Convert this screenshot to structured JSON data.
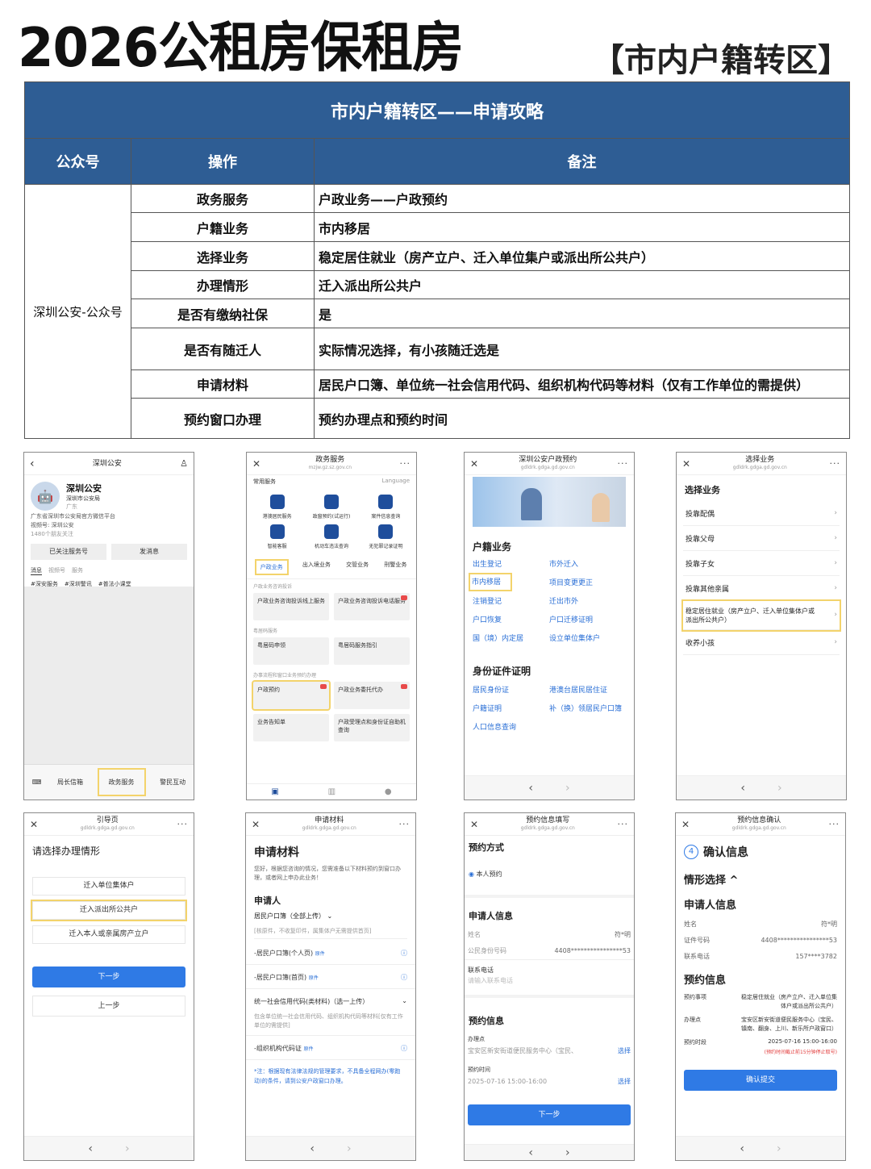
{
  "header": {
    "title": "2026公租房保租房",
    "tag": "【市内户籍转区】"
  },
  "guide": {
    "title": "市内户籍转区——申请攻略",
    "columns": [
      "公众号",
      "操作",
      "备注"
    ],
    "account": "深圳公安-公众号",
    "rows": [
      {
        "op": "政务服务",
        "note": "户政业务——户政预约"
      },
      {
        "op": "户籍业务",
        "note": "市内移居"
      },
      {
        "op": "选择业务",
        "note": "稳定居住就业（房产立户、迁入单位集户或派出所公共户）"
      },
      {
        "op": "办理情形",
        "note": "迁入派出所公共户"
      },
      {
        "op": "是否有缴纳社保",
        "note": "是"
      },
      {
        "op": "是否有随迁人",
        "note": "实际情况选择，有小孩随迁选是"
      },
      {
        "op": "申请材料",
        "note": "居民户口簿、单位统一社会信用代码、组织机构代码等材料（仅有工作单位的需提供）"
      },
      {
        "op": "预约窗口办理",
        "note": "预约办理点和预约时间"
      }
    ]
  },
  "p1": {
    "top_title": "深圳公安",
    "name": "深圳公安",
    "org": "深圳市公安局",
    "region": "广东",
    "desc": "广东省深圳市公安局官方微信平台",
    "video": "视频号: 深圳公安",
    "friends": "1480个朋友关注",
    "btn_follow": "已关注服务号",
    "btn_msg": "发消息",
    "tabs": [
      "消息",
      "视频号",
      "服务"
    ],
    "tags": [
      "#深安服务",
      "#深圳警讯",
      "#普法小课堂"
    ],
    "menu": [
      "局长信箱",
      "政务服务",
      "警民互动"
    ]
  },
  "p2": {
    "top_title": "政务服务",
    "top_sub": "mzjw.gz.sz.gov.cn",
    "section": "常用服务",
    "lang": "Language",
    "icons": [
      "港澳居民服务",
      "政窗预约(试运行)",
      "案件信息查询",
      "智能客服",
      "机动车违法查询",
      "无犯罪记录证明"
    ],
    "tabs": [
      "户政业务",
      "出入境业务",
      "交管业务",
      "刑警业务"
    ],
    "sub1": "户政业务咨询投诉",
    "t1": "户政业务咨询投诉线上服务",
    "t2": "户政业务咨询投诉电话服务",
    "sub2": "粤居码服务",
    "t3": "粤居码申领",
    "t4": "粤居码服务指引",
    "sub3": "办事流程和窗口业务预约办理",
    "t5": "户政预约",
    "t6": "户政业务委托代办",
    "t7": "业务告知单",
    "t8": "户政受理点和身份证自助机查询"
  },
  "p3": {
    "top_title": "深圳公安户政预约",
    "top_sub": "gdldrk.gdga.gd.gov.cn",
    "sec1": "户籍业务",
    "col1": [
      "出生登记",
      "市内移居",
      "注销登记",
      "户口恢复",
      "国（境）内定居"
    ],
    "col2": [
      "市外迁入",
      "项目变更更正",
      "迁出市外",
      "户口迁移证明",
      "设立单位集体户"
    ],
    "sec2": "身份证件证明",
    "col3": [
      "居民身份证",
      "户籍证明",
      "人口信息查询"
    ],
    "col4": [
      "港澳台居民居住证",
      "补（换）领居民户口簿"
    ]
  },
  "p4": {
    "top_title": "选择业务",
    "top_sub": "gdldrk.gdga.gd.gov.cn",
    "heading": "选择业务",
    "items": [
      "投靠配偶",
      "投靠父母",
      "投靠子女",
      "投靠其他亲属",
      "稳定居住就业（房产立户、迁入单位集体户或派出所公共户）",
      "收养小孩"
    ]
  },
  "p5": {
    "top_title": "引导页",
    "top_sub": "gdldrk.gdga.gd.gov.cn",
    "heading": "请选择办理情形",
    "opts": [
      "迁入单位集体户",
      "迁入派出所公共户",
      "迁入本人或亲属房产立户"
    ],
    "next": "下一步",
    "prev": "上一步"
  },
  "p6": {
    "top_title": "申请材料",
    "top_sub": "gdldrk.gdga.gd.gov.cn",
    "heading": "申请材料",
    "intro": "您好，根据您咨询的情况，您需准备以下材料预约到窗口办理，或者网上申办此业务！",
    "applicant": "申请人",
    "book": "居民户口簿（全部上传）",
    "book_hint": "[核原件，不收复印件，属集体户无需提供首页]",
    "m1": "-居民户口簿(个人页)",
    "m2": "-居民户口簿(首页)",
    "tag": "原件",
    "credit": "统一社会信用代码(类材料)（选一上传）",
    "credit_hint": "包含单位统一社会信用代码、组织机构代码等材料[仅有工作单位的需提供]",
    "m3": "-组织机构代码证",
    "note": "*注：根据现有法律法规的管理要求，不具备全程网办(零跑动)的条件，请到公安户政窗口办理。"
  },
  "p7": {
    "top_title": "预约信息填写",
    "top_sub": "gdldrk.gdga.gd.gov.cn",
    "way": "预约方式",
    "self": "本人预约",
    "applicant": "申请人信息",
    "name_l": "姓名",
    "name_v": "符*明",
    "id_l": "公民身份号码",
    "id_v": "4408****************53",
    "tel_l": "联系电话",
    "tel_ph": "请输入联系电话",
    "info": "预约信息",
    "place_l": "办理点",
    "place_v": "宝安区新安街道便民服务中心（宝民、",
    "pick": "选择",
    "time_l": "预约时间",
    "time_v": "2025-07-16 15:00-16:00",
    "next": "下一步"
  },
  "p8": {
    "top_title": "预约信息确认",
    "top_sub": "gdldrk.gdga.gd.gov.cn",
    "step": "4",
    "confirm": "确认信息",
    "situation": "情形选择 ^",
    "applicant": "申请人信息",
    "name_l": "姓名",
    "name_v": "符*明",
    "id_l": "证件号码",
    "id_v": "4408****************53",
    "tel_l": "联系电话",
    "tel_v": "157****3782",
    "info": "预约信息",
    "item_l": "预约事项",
    "item_v": "稳定居住就业（房产立户、迁入单位集体户或派出所公共户）",
    "place_l": "办理点",
    "place_v": "宝安区新安街道便民服务中心（宝民、镇南、翻身、上川、新乐所户政窗口）",
    "time_l": "预约时段",
    "time_v": "2025-07-16 15:00-16:00",
    "time_note": "(预约时间截止前15分钟停止取号)",
    "submit": "确认提交"
  },
  "nav": {
    "back": "‹",
    "fwd": "›"
  }
}
